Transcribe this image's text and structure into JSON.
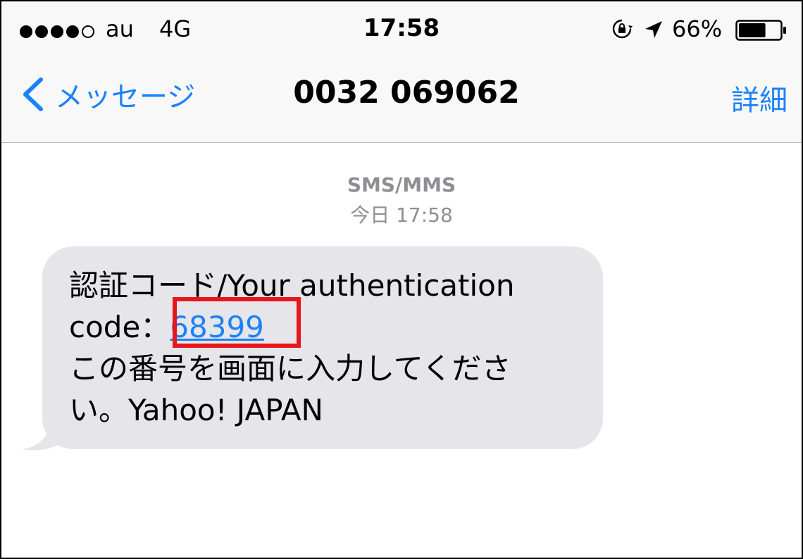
{
  "status_bar": {
    "signal_strength": "4 of 5",
    "carrier": "au",
    "network": "4G",
    "time": "17:58",
    "battery_percent": "66%",
    "battery_level": 0.66,
    "icons": [
      "orientation-lock-icon",
      "location-arrow-icon",
      "battery-icon"
    ]
  },
  "nav": {
    "back_label": "メッセージ",
    "title": "0032 069062",
    "detail_label": "詳細"
  },
  "conversation": {
    "service": "SMS/MMS",
    "timestamp": "今日 17:58"
  },
  "message": {
    "line1": "認証コード/Your authentication",
    "line2_prefix": "code：",
    "code": "68399",
    "line3": "この番号を画面に入力してくださ",
    "line4": "い。Yahoo! JAPAN"
  },
  "colors": {
    "link": "#1a82fb",
    "bubble": "#e5e5ea",
    "highlight": "#e8151b",
    "meta_text": "#8e8e93"
  }
}
